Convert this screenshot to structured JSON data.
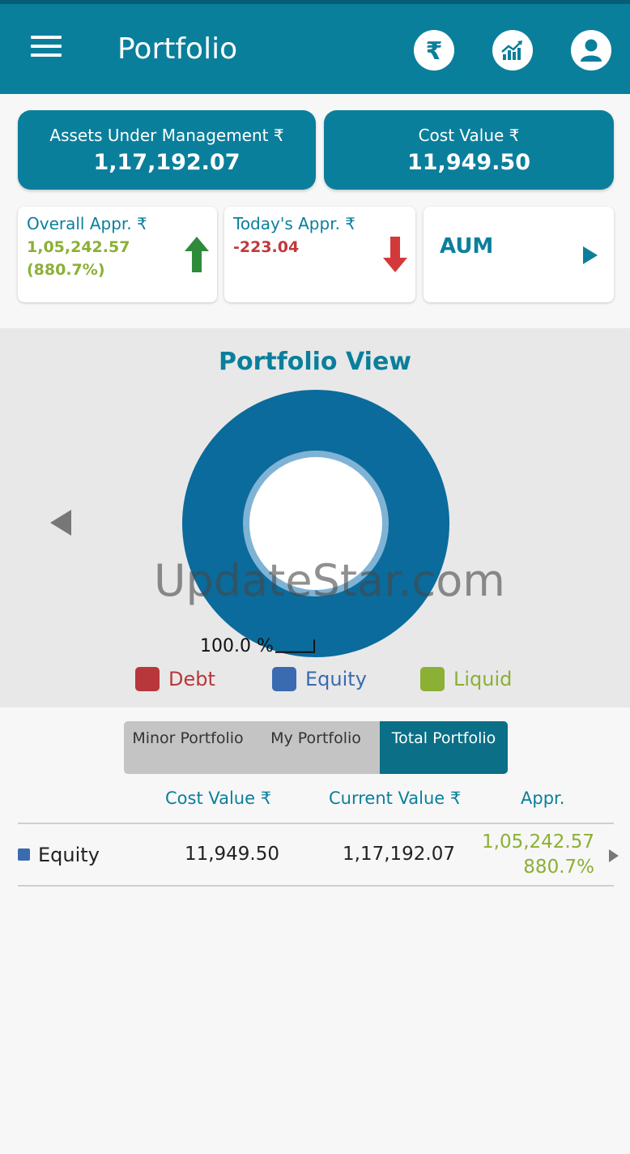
{
  "header": {
    "title": "Portfolio",
    "icons": [
      "menu-icon",
      "rupee-icon",
      "chart-growth-icon",
      "user-icon"
    ]
  },
  "summary": {
    "aum_label": "Assets Under Management ₹",
    "aum_value": "1,17,192.07",
    "cost_label": "Cost Value ₹",
    "cost_value": "11,949.50"
  },
  "stats": {
    "overall_label": "Overall Appr. ₹",
    "overall_value": "1,05,242.57",
    "overall_pct": "(880.7%)",
    "today_label": "Today's Appr. ₹",
    "today_value": "-223.04",
    "aum_nav_label": "AUM"
  },
  "colors": {
    "primary": "#0a7f9c",
    "positive": "#8caf35",
    "negative": "#c0393b",
    "up_arrow": "#2e8b3a",
    "debt": "#b8373a",
    "equity": "#3a6bb0",
    "liquid": "#8caf35",
    "donut": "#0b6b9c"
  },
  "chart_data": {
    "type": "pie",
    "title": "Portfolio View",
    "categories": [
      "Debt",
      "Equity",
      "Liquid"
    ],
    "values": [
      0,
      100.0,
      0
    ],
    "slice_labels": [
      "100.0 %"
    ],
    "legend_position": "bottom"
  },
  "portfolio_view": {
    "title": "Portfolio View",
    "slice_label": "100.0 %",
    "watermark": "UpdateStar.com",
    "legend": [
      {
        "label": "Debt",
        "color": "#b8373a"
      },
      {
        "label": "Equity",
        "color": "#3a6bb0"
      },
      {
        "label": "Liquid",
        "color": "#8caf35"
      }
    ]
  },
  "segments": {
    "minor": "Minor Portfolio",
    "my": "My Portfolio",
    "total": "Total Portfolio",
    "selected": "Total Portfolio"
  },
  "table": {
    "headers": [
      "Cost Value ₹",
      "Current Value ₹",
      "Appr."
    ],
    "rows": [
      {
        "name": "Equity",
        "cost": "11,949.50",
        "current": "1,17,192.07",
        "appr": "1,05,242.57",
        "appr_pct": "880.7%"
      }
    ]
  }
}
